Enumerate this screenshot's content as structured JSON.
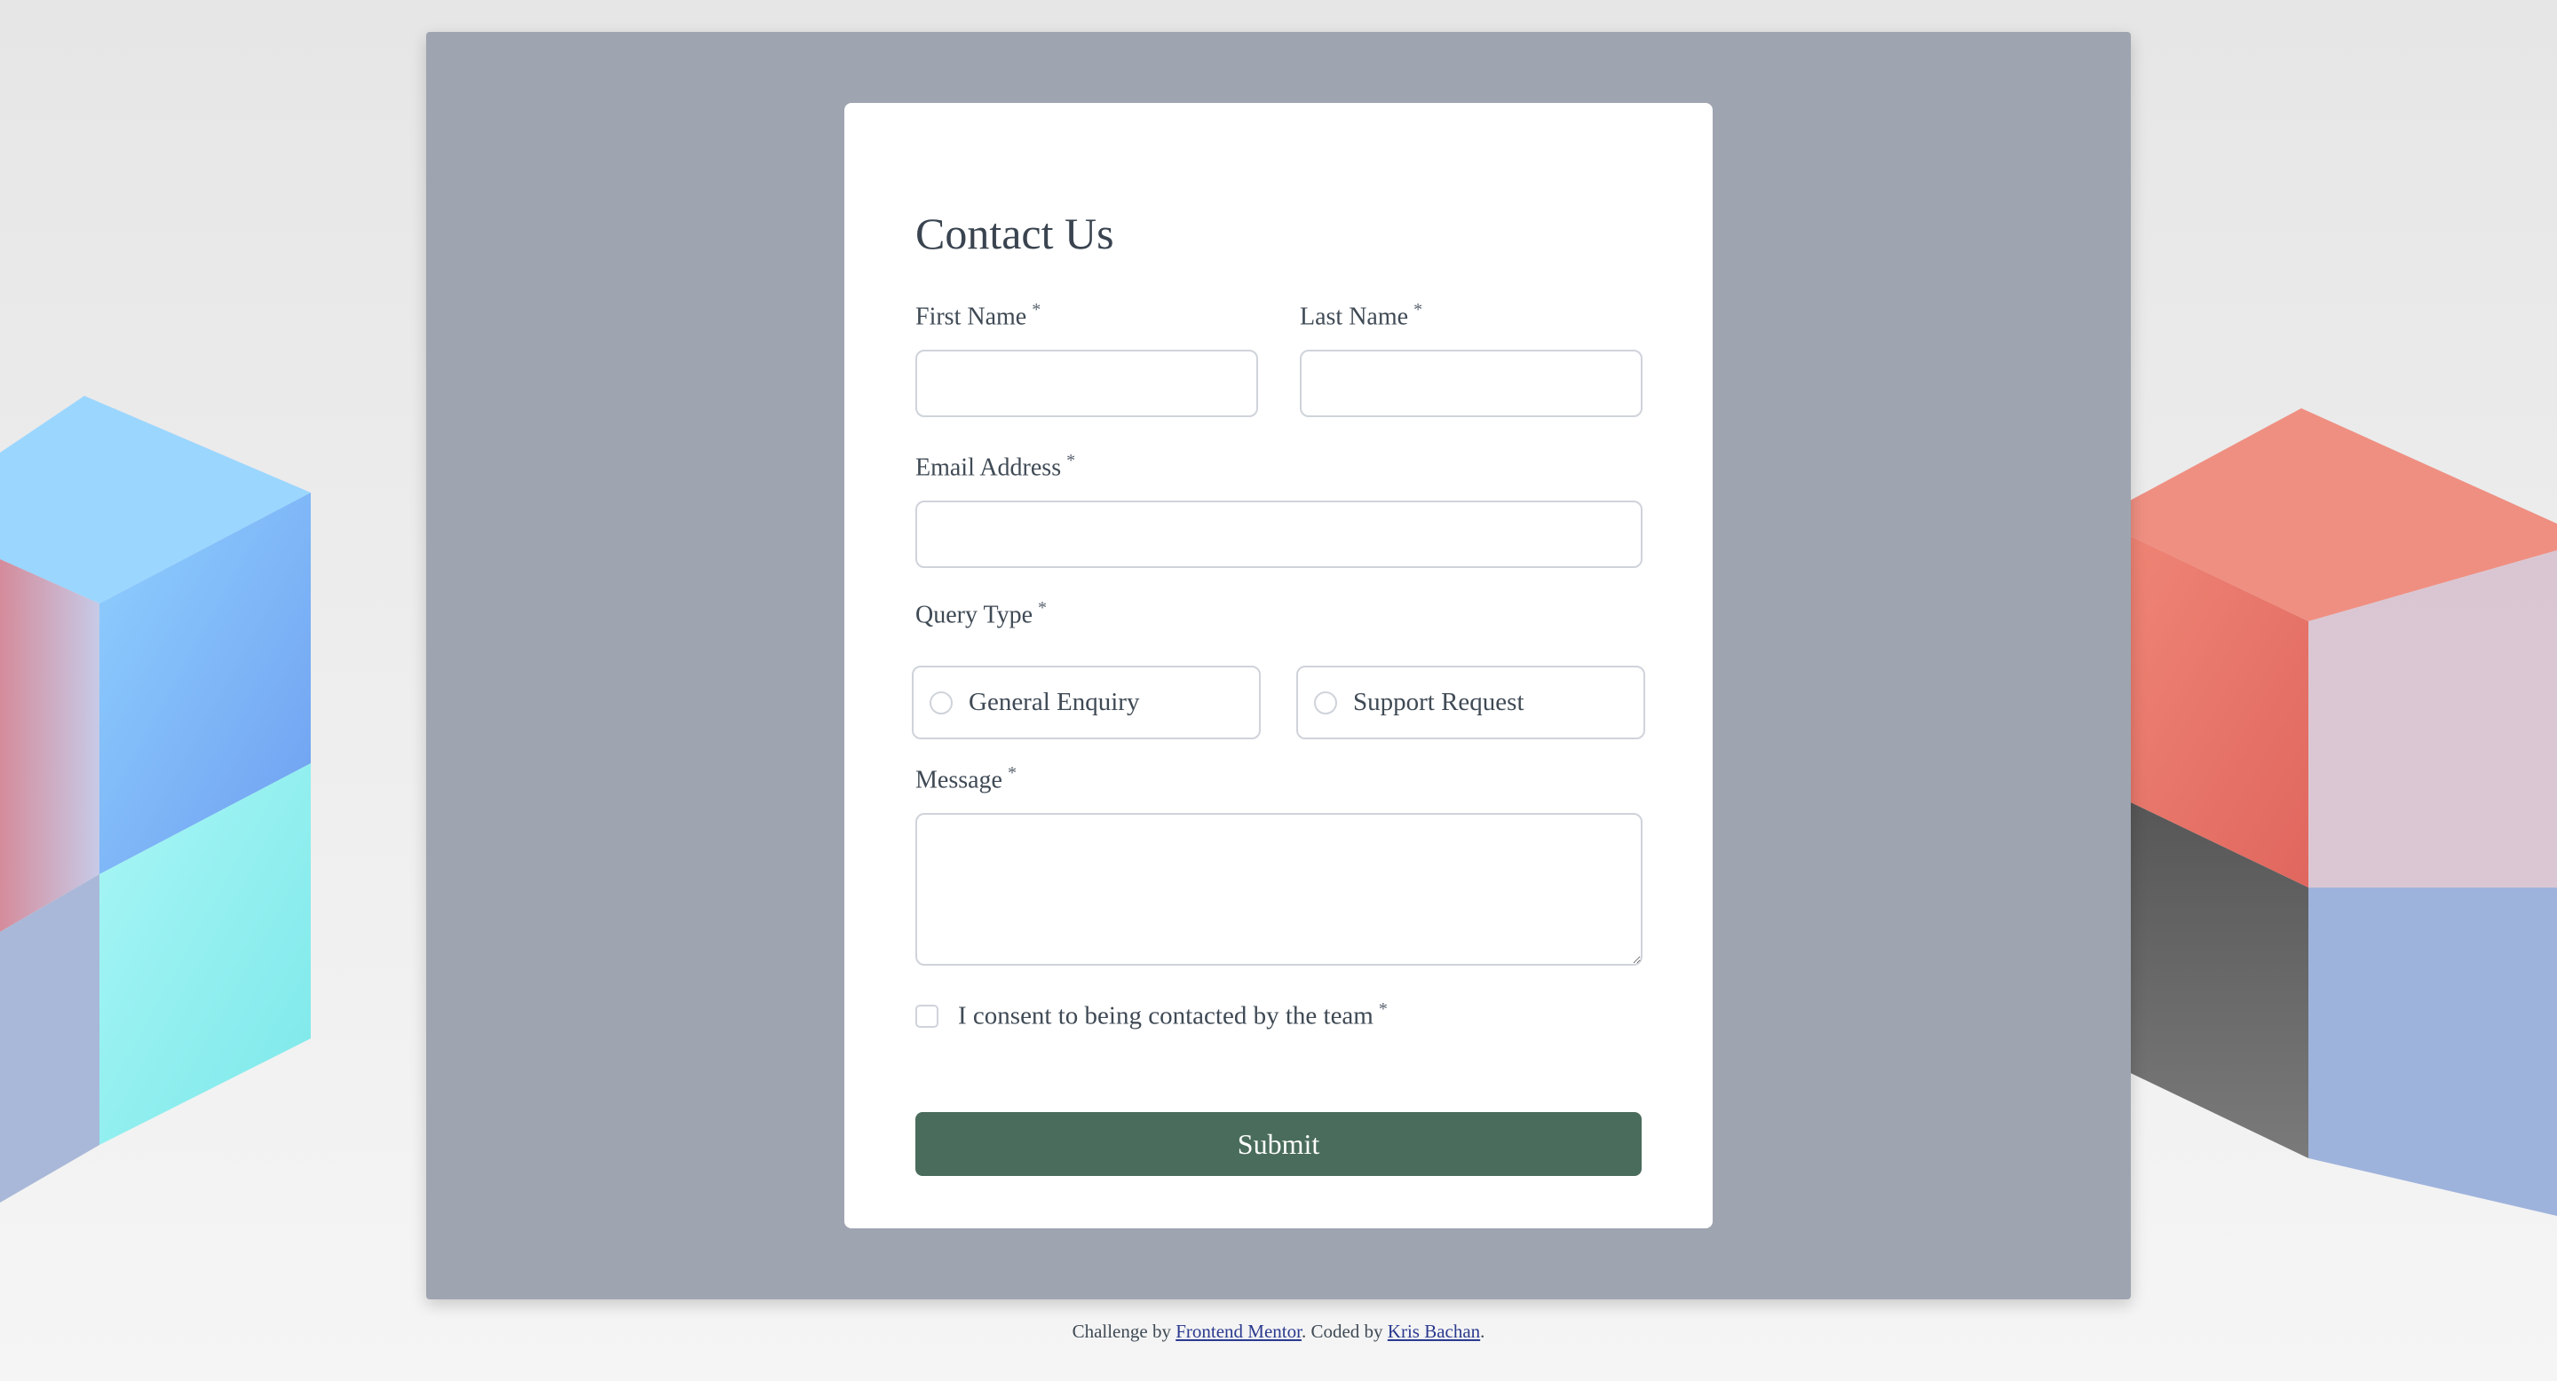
{
  "form": {
    "title": "Contact Us",
    "required_mark": "*",
    "first_name_label": "First Name",
    "last_name_label": "Last Name",
    "email_label": "Email Address",
    "query_type_label": "Query Type",
    "query_options": [
      "General Enquiry",
      "Support Request"
    ],
    "message_label": "Message",
    "consent_label": "I consent to being contacted by the team",
    "submit_label": "Submit",
    "first_name_value": "",
    "last_name_value": "",
    "email_value": "",
    "message_value": ""
  },
  "footer": {
    "prefix": "Challenge by ",
    "link1": "Frontend Mentor",
    "middle": ". Coded by ",
    "link2": "Kris Bachan",
    "suffix": "."
  },
  "colors": {
    "panel": "#9ea4b0",
    "submit_bg": "#4a6c5c",
    "link": "#2b3a8f"
  }
}
